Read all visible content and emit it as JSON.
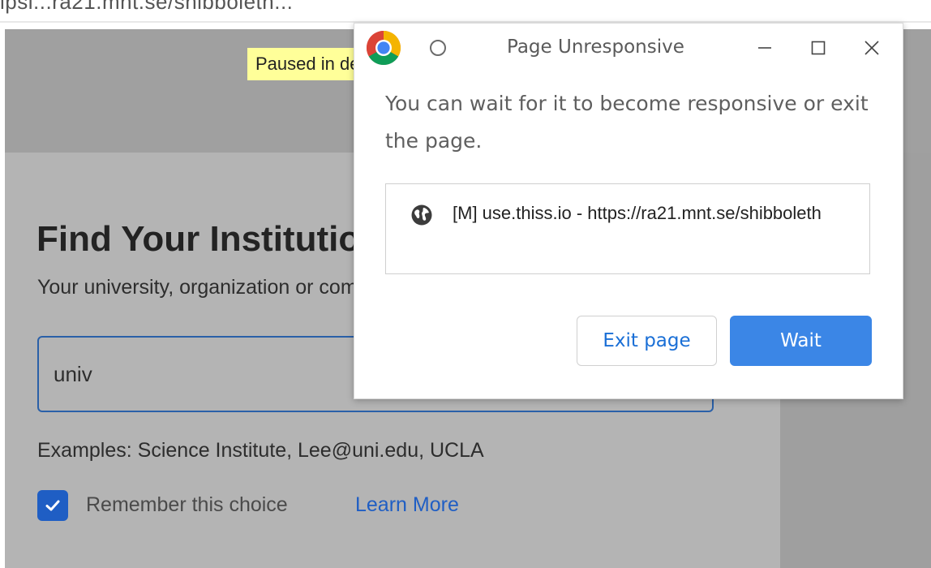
{
  "background_page": {
    "url_fragment": "ipsi...ra21.mnt.se/shibboleth...",
    "paused_badge": "Paused in debugger",
    "title": "Find Your Institution",
    "subtitle": "Your university, organization or company",
    "search": {
      "value": "univ"
    },
    "examples": "Examples: Science Institute, Lee@uni.edu, UCLA",
    "remember_label": "Remember this choice",
    "remember_checked": true,
    "learn_more": "Learn More"
  },
  "dialog": {
    "title": "Page Unresponsive",
    "message": "You can wait for it to become responsive or exit the page.",
    "pages": [
      {
        "label": "[M] use.thiss.io - https://ra21.mnt.se/shibboleth",
        "icon": "globe-icon"
      }
    ],
    "exit_label": "Exit page",
    "wait_label": "Wait"
  },
  "colors": {
    "accent_blue": "#3b86e6",
    "link_blue": "#1a6fd6",
    "paused_yellow": "#ffff99",
    "overlay_gray": "#b4b4b4"
  }
}
